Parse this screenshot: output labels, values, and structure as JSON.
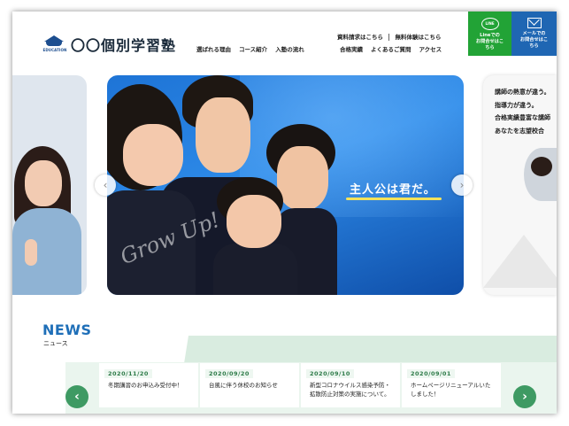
{
  "header": {
    "logo_text": "EDUCATION",
    "site_title": "〇〇個別学習塾",
    "top_links": [
      "資料請求はこちら",
      "無料体験はこちら"
    ],
    "nav_row1": [
      "選ばれる理由",
      "コース紹介",
      "入塾の流れ"
    ],
    "nav_row2": [
      "合格実績",
      "よくあるご質問",
      "アクセス"
    ],
    "line_icon": "LINE",
    "line_button": [
      "Lineでの",
      "お問合せはこ",
      "ちら"
    ],
    "mail_button": [
      "メールでの",
      "お問合せはこ",
      "ちら"
    ]
  },
  "slider": {
    "main_catch": "主人公は君だ。",
    "main_script": "Grow Up!",
    "right_lines": [
      "講師の熱意が違う。",
      "指導力が違う。",
      "合格実績豊富な講師",
      "あなたを志望校合"
    ],
    "prev_icon": "chevron-left-icon",
    "next_icon": "chevron-right-icon"
  },
  "news": {
    "title": "NEWS",
    "subtitle": "ニュース",
    "items": [
      {
        "date": "2020/11/20",
        "text": "冬期講習のお申込み受付中！"
      },
      {
        "date": "2020/09/20",
        "text": "台風に伴う休校のお知らせ"
      },
      {
        "date": "2020/09/10",
        "text": "新型コロナウイルス感染予防・拡散防止対策の実施について。"
      },
      {
        "date": "2020/09/01",
        "text": "ホームページリニューアルいたしました！"
      }
    ]
  },
  "colors": {
    "brand_blue": "#1f66b3",
    "line_green": "#22a336",
    "news_green": "#3e9a63"
  }
}
